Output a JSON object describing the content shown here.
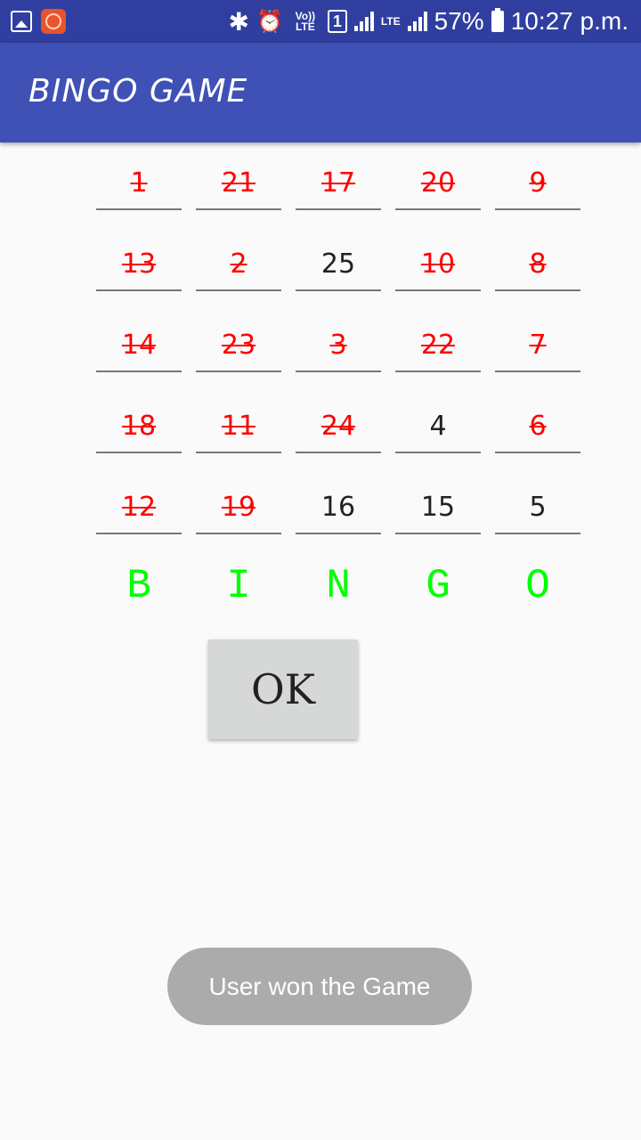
{
  "status_bar": {
    "left_icons": [
      "image-icon",
      "app-notification-icon"
    ],
    "bluetooth": "✱",
    "alarm": "⏰",
    "volte": "Vo)) LTE",
    "sim": "1",
    "lte": "LTE",
    "battery": "57%",
    "time": "10:27 p.m."
  },
  "app_bar": {
    "title": "BINGO GAME"
  },
  "board": {
    "rows": [
      [
        {
          "n": "1",
          "crossed": true
        },
        {
          "n": "21",
          "crossed": true
        },
        {
          "n": "17",
          "crossed": true
        },
        {
          "n": "20",
          "crossed": true
        },
        {
          "n": "9",
          "crossed": true
        }
      ],
      [
        {
          "n": "13",
          "crossed": true
        },
        {
          "n": "2",
          "crossed": true
        },
        {
          "n": "25",
          "crossed": false
        },
        {
          "n": "10",
          "crossed": true
        },
        {
          "n": "8",
          "crossed": true
        }
      ],
      [
        {
          "n": "14",
          "crossed": true
        },
        {
          "n": "23",
          "crossed": true
        },
        {
          "n": "3",
          "crossed": true
        },
        {
          "n": "22",
          "crossed": true
        },
        {
          "n": "7",
          "crossed": true
        }
      ],
      [
        {
          "n": "18",
          "crossed": true
        },
        {
          "n": "11",
          "crossed": true
        },
        {
          "n": "24",
          "crossed": true
        },
        {
          "n": "4",
          "crossed": false
        },
        {
          "n": "6",
          "crossed": true
        }
      ],
      [
        {
          "n": "12",
          "crossed": true
        },
        {
          "n": "19",
          "crossed": true
        },
        {
          "n": "16",
          "crossed": false
        },
        {
          "n": "15",
          "crossed": false
        },
        {
          "n": "5",
          "crossed": false
        }
      ]
    ]
  },
  "bingo_letters": [
    "B",
    "I",
    "N",
    "G",
    "O"
  ],
  "ok_button": {
    "label": "OK"
  },
  "toast": {
    "text": "User won the Game"
  },
  "colors": {
    "app_bar": "#3f51b5",
    "status_bar": "#303f9f",
    "crossed_number": "#ff0000",
    "bingo_letter": "#00ff00"
  }
}
